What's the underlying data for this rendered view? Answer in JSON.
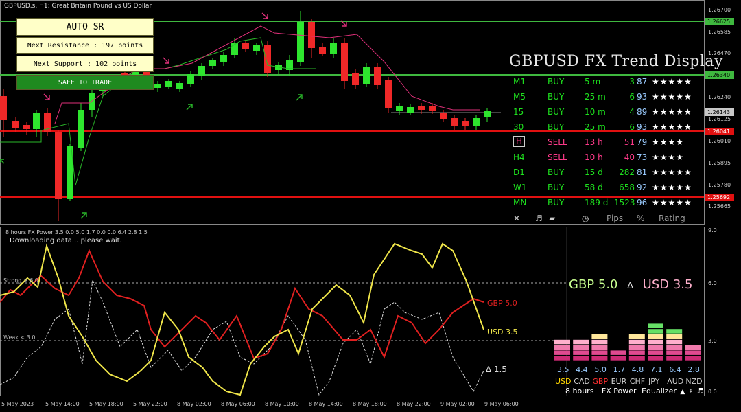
{
  "window": {
    "title": "GBPUSD.s, H1:  Great Britain Pound vs US Dollar",
    "sub_title": "8 hours FX Power 3.5 0.0 5.0 1.7 0.0 0.0 6.4 2.8 1.5",
    "loading": "Downloading data... please wait."
  },
  "auto_sr": {
    "title": "AUTO SR",
    "next_resistance": "Next Resistance : 197 points",
    "next_support": "Next Support : 102 points",
    "status": "SAFE TO TRADE"
  },
  "trend_display": {
    "title": "GBPUSD FX Trend Display",
    "rows": [
      {
        "tf": "M1",
        "signal": "BUY",
        "time": "5 m",
        "pips": "3",
        "pct": "87",
        "rating": "★★★★★",
        "signal_color": "#1ee01e"
      },
      {
        "tf": "M5",
        "signal": "BUY",
        "time": "25 m",
        "pips": "6",
        "pct": "93",
        "rating": "★★★★★",
        "signal_color": "#1ee01e"
      },
      {
        "tf": "15",
        "signal": "BUY",
        "time": "10 m",
        "pips": "4",
        "pct": "89",
        "rating": "★★★★★",
        "signal_color": "#1ee01e"
      },
      {
        "tf": "30",
        "signal": "BUY",
        "time": "25 m",
        "pips": "6",
        "pct": "93",
        "rating": "★★★★★",
        "signal_color": "#1ee01e"
      },
      {
        "tf": "H",
        "signal": "SELL",
        "time": "13 h",
        "pips": "51",
        "pct": "79",
        "rating": "★★★★",
        "signal_color": "#ff3a8a"
      },
      {
        "tf": "H4",
        "signal": "SELL",
        "time": "10 h",
        "pips": "40",
        "pct": "73",
        "rating": "★★★★",
        "signal_color": "#ff3a8a"
      },
      {
        "tf": "D1",
        "signal": "BUY",
        "time": "15 d",
        "pips": "282",
        "pct": "81",
        "rating": "★★★★★",
        "signal_color": "#1ee01e"
      },
      {
        "tf": "W1",
        "signal": "BUY",
        "time": "58 d",
        "pips": "658",
        "pct": "92",
        "rating": "★★★★★",
        "signal_color": "#1ee01e"
      },
      {
        "tf": "MN",
        "signal": "BUY",
        "time": "189 d",
        "pips": "1523",
        "pct": "96",
        "rating": "★★★★★",
        "signal_color": "#1ee01e"
      }
    ],
    "header": {
      "close": "✕",
      "music": "♬",
      "clock": "◷",
      "pips": "Pips",
      "pct": "%",
      "rating": "Rating"
    }
  },
  "price_axis": {
    "labels": [
      "1.26700",
      "1.26585",
      "1.26470",
      "1.26355",
      "1.26240",
      "1.26125",
      "1.26010",
      "1.25895",
      "1.25780",
      "1.25665"
    ],
    "tags": [
      {
        "text": "1.26625",
        "bg": "#3fb83f",
        "color": "#000"
      },
      {
        "text": "1.26340",
        "bg": "#3fb83f",
        "color": "#000"
      },
      {
        "text": "1.26143",
        "bg": "#c8c8c8",
        "color": "#000"
      },
      {
        "text": "1.26041",
        "bg": "#e01010",
        "color": "#fff"
      },
      {
        "text": "1.25692",
        "bg": "#e01010",
        "color": "#fff"
      }
    ]
  },
  "time_axis": [
    "5 May 2023",
    "5 May 14:00",
    "5 May 18:00",
    "5 May 22:00",
    "8 May 02:00",
    "8 May 06:00",
    "8 May 10:00",
    "8 May 14:00",
    "8 May 18:00",
    "8 May 22:00",
    "9 May 02:00",
    "9 May 06:00"
  ],
  "indicator_axis": [
    "9.0",
    "6.0",
    "3.0",
    "0.0"
  ],
  "power": {
    "strong_label": "Strong > 6.0",
    "weak_label": "Weak < 3.0",
    "headline_gbp": "GBP 5.0",
    "headline_delta": "∆",
    "headline_usd": "USD 3.5",
    "line_gbp": "GBP 5.0",
    "line_usd": "USD 3.5",
    "line_delta": "∆ 1.5"
  },
  "equalizer": {
    "currencies": [
      "USD",
      "CAD",
      "GBP",
      "EUR",
      "CHF",
      "JPY",
      "AUD",
      "NZD"
    ],
    "values": [
      "3.5",
      "4.4",
      "5.0",
      "1.7",
      "4.8",
      "7.1",
      "6.4",
      "2.8"
    ],
    "label_colors": [
      "#ffd700",
      "#cfcfcf",
      "#ff3030",
      "#cfcfcf",
      "#cfcfcf",
      "#cfcfcf",
      "#cfcfcf",
      "#cfcfcf"
    ],
    "footer_hours": "8 hours",
    "footer_power": "FX Power",
    "footer_eq": "Equalizer",
    "footer_arrow": "▲",
    "footer_cross": "⌖",
    "footer_music": "♬"
  },
  "colors": {
    "buy": "#1ee01e",
    "sell": "#ff3a8a",
    "resistance": "#3fb83f",
    "support": "#e01010",
    "gbp_line": "#e02020",
    "usd_line": "#f0e64a"
  }
}
